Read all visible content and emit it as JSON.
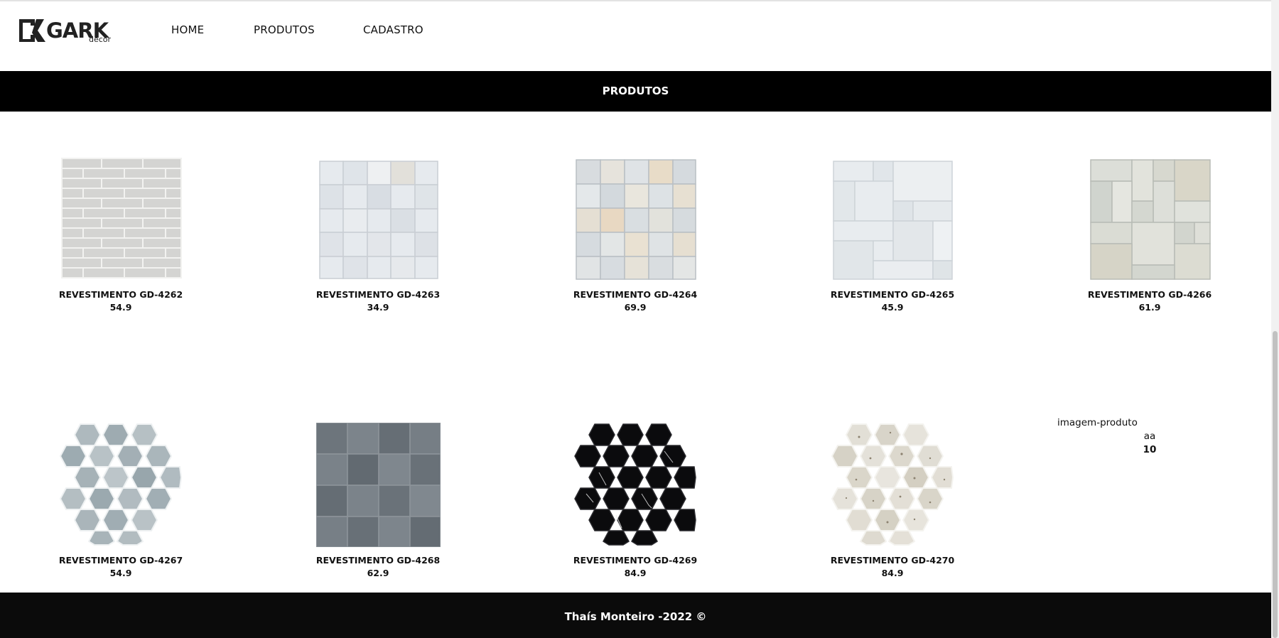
{
  "brand": {
    "logo_text": "GARK",
    "logo_sub": "decor"
  },
  "nav": {
    "items": [
      {
        "label": "HOME"
      },
      {
        "label": "PRODUTOS"
      },
      {
        "label": "CADASTRO"
      }
    ]
  },
  "banner": {
    "title": "PRODUTOS"
  },
  "products": [
    {
      "name": "REVESTIMENTO GD-4262",
      "price": "54.9"
    },
    {
      "name": "REVESTIMENTO GD-4263",
      "price": "34.9"
    },
    {
      "name": "REVESTIMENTO GD-4264",
      "price": "69.9"
    },
    {
      "name": "REVESTIMENTO GD-4265",
      "price": "45.9"
    },
    {
      "name": "REVESTIMENTO GD-4266",
      "price": "61.9"
    },
    {
      "name": "REVESTIMENTO GD-4267",
      "price": "54.9"
    },
    {
      "name": "REVESTIMENTO GD-4268",
      "price": "62.9"
    },
    {
      "name": "REVESTIMENTO GD-4269",
      "price": "84.9"
    },
    {
      "name": "REVESTIMENTO GD-4270",
      "price": "84.9"
    }
  ],
  "broken_product": {
    "alt_text": "imagem-produto",
    "name": "aa",
    "price": "10"
  },
  "footer": {
    "text": "Thaís Monteiro -2022 ©"
  },
  "colors": {
    "banner_bg": "#000000",
    "footer_bg": "#0b0b0b",
    "text": "#111111"
  }
}
